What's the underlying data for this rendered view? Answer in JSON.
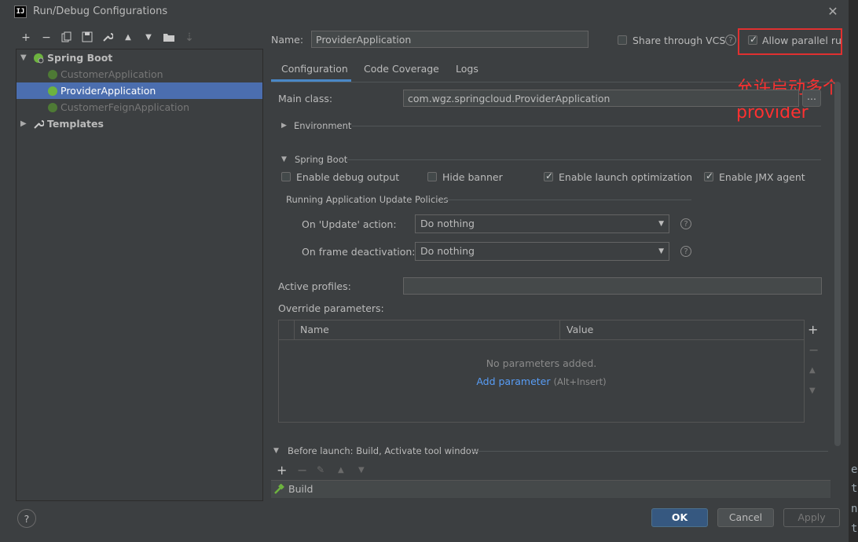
{
  "window": {
    "title": "Run/Debug Configurations",
    "app_icon": "IJ"
  },
  "toolbar": {
    "icons": [
      "add-icon",
      "remove-icon",
      "copy-icon",
      "save-icon",
      "wrench-icon",
      "move-up-icon",
      "move-down-icon",
      "folder-icon",
      "sort-icon"
    ]
  },
  "tree": {
    "root_label": "Spring Boot",
    "items": [
      "CustomerApplication",
      "ProviderApplication",
      "CustomerFeignApplication"
    ],
    "templates_label": "Templates"
  },
  "name_field": {
    "label": "Name:",
    "value": "ProviderApplication"
  },
  "share_vcs": {
    "label": "Share through VCS",
    "checked": false
  },
  "allow_parallel": {
    "label": "Allow parallel run",
    "checked": true
  },
  "annotation": {
    "line1": "允许启动多个",
    "line2": "provider",
    "color": "#ff3030"
  },
  "tabs": [
    "Configuration",
    "Code Coverage",
    "Logs"
  ],
  "main_class": {
    "label": "Main class:",
    "value": "com.wgz.springcloud.ProviderApplication",
    "browse": "..."
  },
  "environment": {
    "label": "Environment"
  },
  "spring_boot": {
    "label": "Spring Boot",
    "checkboxes": [
      {
        "label": "Enable debug output",
        "checked": false
      },
      {
        "label": "Hide banner",
        "checked": false
      },
      {
        "label": "Enable launch optimization",
        "checked": true
      },
      {
        "label": "Enable JMX agent",
        "checked": true
      }
    ],
    "policies_title": "Running Application Update Policies",
    "update_action": {
      "label": "On 'Update' action:",
      "value": "Do nothing"
    },
    "frame_deactivation": {
      "label": "On frame deactivation:",
      "value": "Do nothing"
    }
  },
  "active_profiles": {
    "label": "Active profiles:",
    "value": ""
  },
  "override": {
    "label": "Override parameters:",
    "columns": [
      "Name",
      "Value"
    ],
    "empty_text": "No parameters added.",
    "add_link": "Add parameter",
    "add_hint": "(Alt+Insert)"
  },
  "before_launch": {
    "label": "Before launch: Build, Activate tool window",
    "item": "Build"
  },
  "buttons": {
    "ok": "OK",
    "cancel": "Cancel",
    "apply": "Apply",
    "help": "?"
  },
  "colors": {
    "accent": "#4a88c7",
    "selection": "#4b6eaf",
    "primary_button": "#365880",
    "annotation_red": "#e03030"
  }
}
